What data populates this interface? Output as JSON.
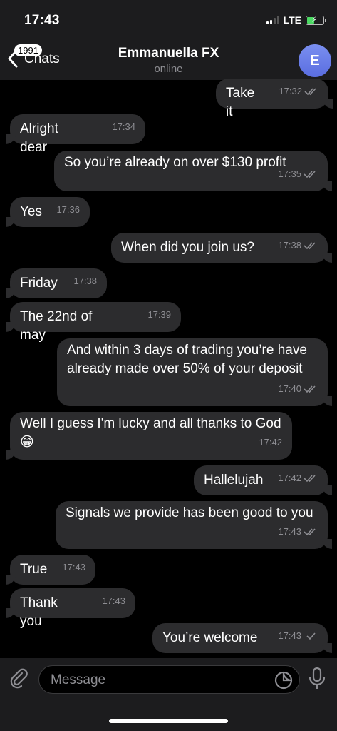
{
  "status_bar": {
    "time": "17:43",
    "network": "LTE"
  },
  "nav": {
    "back_badge": "1991",
    "back_label": "Chats",
    "title": "Emmanuella FX",
    "status": "online",
    "avatar_letter": "E"
  },
  "messages": [
    {
      "dir": "out",
      "text": "Take it",
      "time": "17:32",
      "read": true
    },
    {
      "dir": "in",
      "text": "Alright dear",
      "time": "17:34"
    },
    {
      "dir": "out",
      "text": "So you’re already on over $130 profit",
      "time": "17:35",
      "read": true
    },
    {
      "dir": "in",
      "text": "Yes",
      "time": "17:36"
    },
    {
      "dir": "out",
      "text": "When did you join us?",
      "time": "17:38",
      "read": true
    },
    {
      "dir": "in",
      "text": "Friday",
      "time": "17:38"
    },
    {
      "dir": "in",
      "text": "The 22nd of may",
      "time": "17:39"
    },
    {
      "dir": "out",
      "text": "And within 3 days of trading you’re have already made over 50% of your deposit",
      "time": "17:40",
      "read": true
    },
    {
      "dir": "in",
      "text": "Well I guess I'm lucky and all thanks to God😁",
      "time": "17:42"
    },
    {
      "dir": "out",
      "text": "Hallelujah",
      "time": "17:42",
      "read": true
    },
    {
      "dir": "out",
      "text": "Signals we provide has been good to you",
      "time": "17:43",
      "read": true
    },
    {
      "dir": "in",
      "text": "True",
      "time": "17:43"
    },
    {
      "dir": "in",
      "text": "Thank you",
      "time": "17:43"
    },
    {
      "dir": "out",
      "text": "You’re welcome",
      "time": "17:43",
      "read": false
    }
  ],
  "input": {
    "placeholder": "Message"
  },
  "icons": {
    "back": "chevron-left-icon",
    "attach": "paperclip-icon",
    "sticker": "sticker-icon",
    "mic": "microphone-icon",
    "read_receipt": "double-check-icon",
    "delivered_receipt": "single-check-icon"
  },
  "colors": {
    "background": "#000000",
    "bubble": "#2c2c2e",
    "bar": "#1c1c1e",
    "avatar": "#6a7ce8",
    "muted_text": "#8e8e93"
  }
}
